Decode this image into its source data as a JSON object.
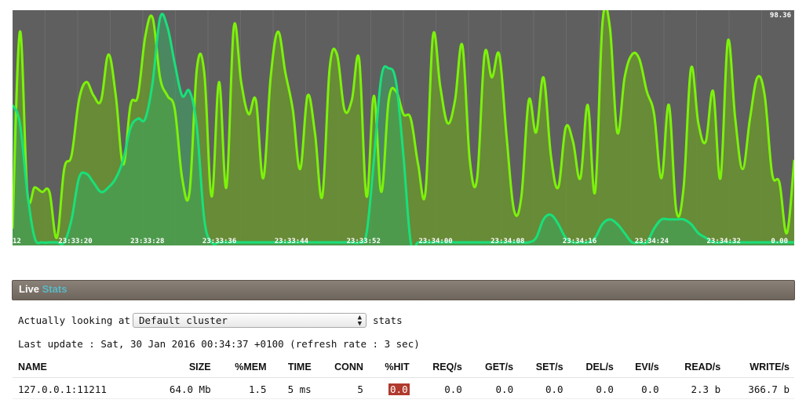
{
  "graph": {
    "max_label": "98.36",
    "min_label": "0.00",
    "time_labels": [
      "12",
      "23:33:20",
      "23:33:28",
      "23:33:36",
      "23:33:44",
      "23:33:52",
      "23:34:00",
      "23:34:08",
      "23:34:16",
      "23:34:24",
      "23:34:32"
    ],
    "colors": {
      "background": "#5f5f5f",
      "series_a": "#7cf20a",
      "series_b": "#18e07a",
      "fill_a": "#6a9a2a",
      "fill_b": "#3aa860",
      "grid": "#6c6c6c"
    },
    "series": [
      {
        "values": [
          6,
          92,
          22,
          24,
          22,
          22,
          2,
          32,
          38,
          62,
          70,
          64,
          62,
          82,
          64,
          34,
          60,
          64,
          90,
          98,
          72,
          64,
          58,
          28,
          22,
          76,
          74,
          20,
          70,
          24,
          94,
          70,
          56,
          62,
          28,
          72,
          92,
          74,
          58,
          32,
          64,
          48,
          20,
          76,
          82,
          58,
          62,
          80,
          20,
          64,
          22,
          62,
          66,
          56,
          54,
          34,
          22,
          90,
          68,
          52,
          62,
          86,
          36,
          28,
          82,
          72,
          82,
          46,
          14,
          20,
          62,
          48,
          72,
          38,
          24,
          50,
          44,
          28,
          60,
          22,
          96,
          94,
          48,
          72,
          82,
          80,
          66,
          56,
          28,
          60,
          14,
          24,
          76,
          52,
          44,
          66,
          28,
          88,
          54,
          32,
          54,
          72,
          64,
          30,
          26,
          4,
          36
        ]
      },
      {
        "values": [
          60,
          52,
          22,
          2,
          0,
          0,
          0,
          0,
          10,
          28,
          30,
          26,
          22,
          24,
          28,
          36,
          50,
          54,
          54,
          70,
          98,
          94,
          78,
          64,
          66,
          50,
          10,
          0,
          0,
          0,
          0,
          0,
          0,
          0,
          0,
          0,
          0,
          0,
          0,
          0,
          0,
          0,
          0,
          0,
          0,
          0,
          0,
          0,
          4,
          36,
          72,
          76,
          70,
          38,
          0,
          0,
          0,
          0,
          0,
          0,
          0,
          0,
          0,
          0,
          0,
          0,
          0,
          0,
          0,
          0,
          0,
          2,
          10,
          12,
          8,
          2,
          0,
          0,
          0,
          2,
          8,
          10,
          8,
          4,
          0,
          0,
          0,
          6,
          10,
          10,
          10,
          10,
          8,
          4,
          2,
          0,
          0,
          0,
          0,
          0,
          0,
          0,
          0,
          0,
          0,
          0,
          0
        ]
      }
    ]
  },
  "panel": {
    "title_main": "Live",
    "title_accent": "Stats"
  },
  "controls": {
    "looking_label": "Actually looking at",
    "cluster_selected": "Default cluster",
    "stats_label": "stats",
    "last_update": "Last update : Sat, 30 Jan 2016 00:34:37 +0100 (refresh rate : 3 sec)"
  },
  "table": {
    "headers": [
      "NAME",
      "SIZE",
      "%MEM",
      "TIME",
      "CONN",
      "%HIT",
      "REQ/s",
      "GET/s",
      "SET/s",
      "DEL/s",
      "EVI/s",
      "READ/s",
      "WRITE/s"
    ],
    "rows": [
      {
        "name": "127.0.0.1:11211",
        "size": "64.0 Mb",
        "mem": "1.5",
        "time": "5 ms",
        "conn": "5",
        "hit": "0.0",
        "req": "0.0",
        "get": "0.0",
        "set": "0.0",
        "del": "0.0",
        "evi": "0.0",
        "read": "2.3 b",
        "write": "366.7 b"
      }
    ]
  }
}
